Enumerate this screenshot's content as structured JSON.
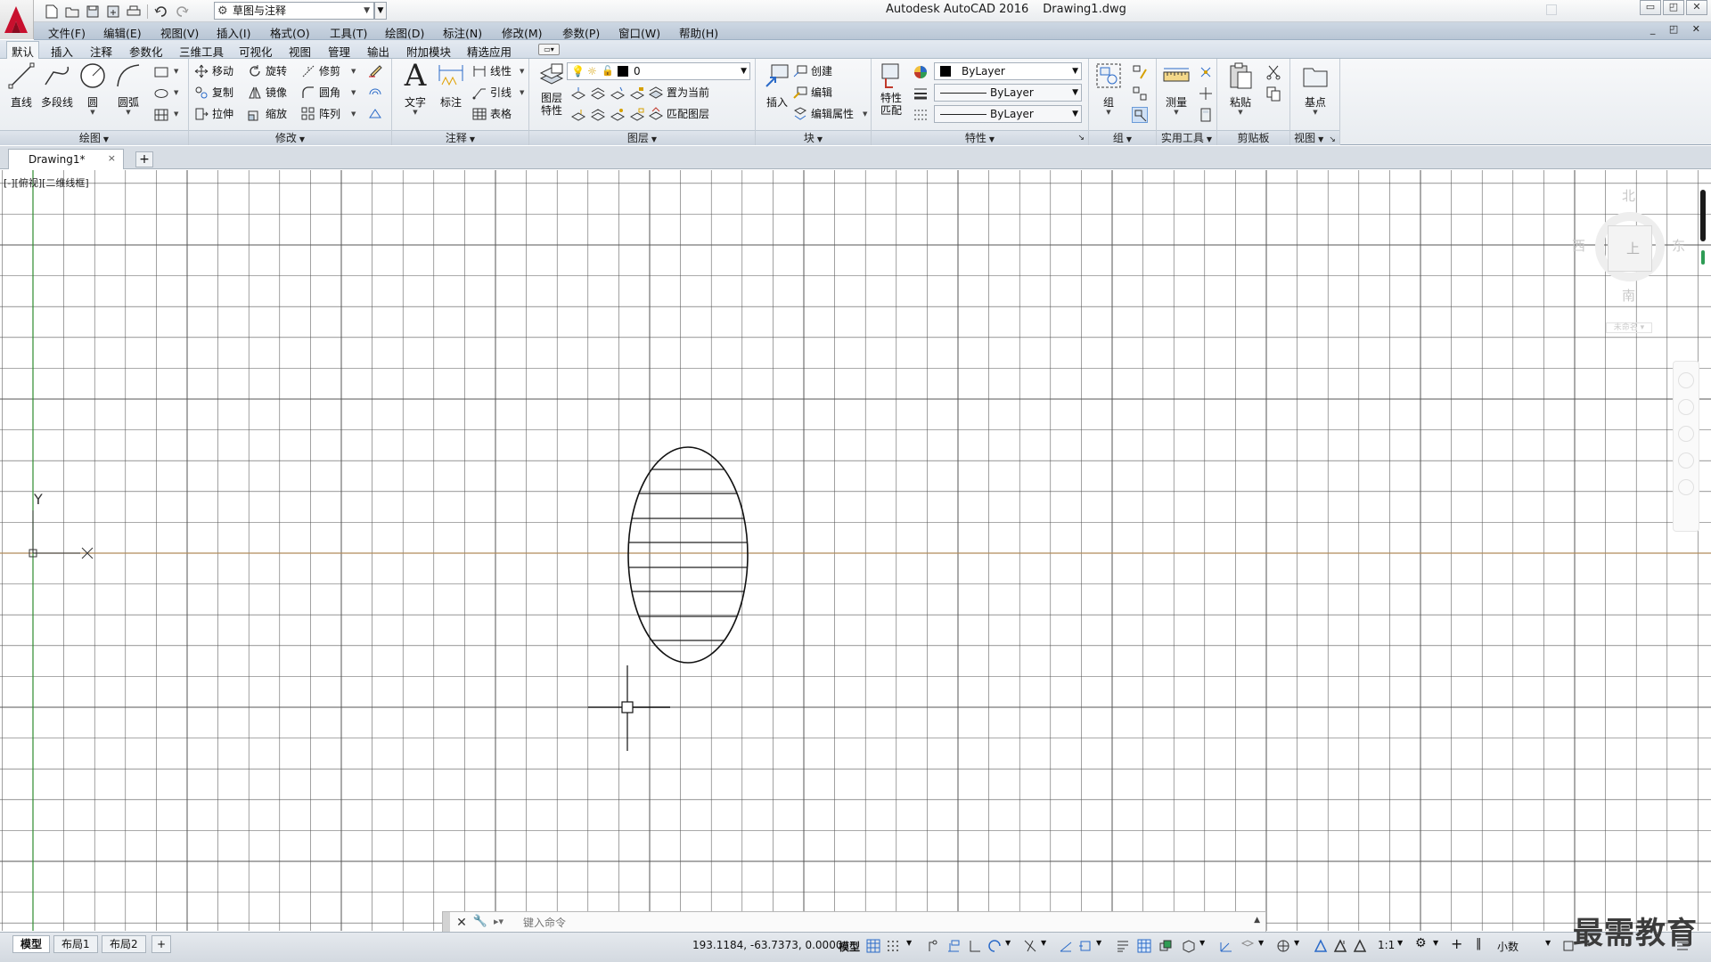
{
  "window": {
    "app_title": "Autodesk AutoCAD 2016",
    "document_title": "Drawing1.dwg",
    "workspace": "草图与注释",
    "controls": {
      "minimize": "▭",
      "restore": "◰",
      "close": "✕"
    }
  },
  "menu": [
    "文件(F)",
    "编辑(E)",
    "视图(V)",
    "插入(I)",
    "格式(O)",
    "工具(T)",
    "绘图(D)",
    "标注(N)",
    "修改(M)",
    "参数(P)",
    "窗口(W)",
    "帮助(H)"
  ],
  "menu_controls": "_ ◰ ✕",
  "ribbon_tabs": [
    "默认",
    "插入",
    "注释",
    "参数化",
    "三维工具",
    "可视化",
    "视图",
    "管理",
    "输出",
    "附加模块",
    "精选应用"
  ],
  "ribbon": {
    "draw": {
      "label": "绘图",
      "line": "直线",
      "polyline": "多段线",
      "circle": "圆",
      "arc": "圆弧"
    },
    "modify": {
      "label": "修改",
      "move": "移动",
      "rotate": "旋转",
      "trim": "修剪",
      "copy": "复制",
      "mirror": "镜像",
      "fillet": "圆角",
      "stretch": "拉伸",
      "scale": "缩放",
      "array": "阵列"
    },
    "annotation": {
      "label": "注释",
      "text": "文字",
      "dimension": "标注",
      "linear": "线性",
      "leader": "引线",
      "table": "表格"
    },
    "layers": {
      "label": "图层",
      "layer_properties_line1": "图层",
      "layer_properties_line2": "特性",
      "current_layer": "0",
      "set_current": "置为当前",
      "match_layer": "匹配图层"
    },
    "block": {
      "label": "块",
      "insert": "插入",
      "create": "创建",
      "edit": "编辑",
      "edit_attributes": "编辑属性"
    },
    "properties": {
      "label": "特性",
      "match_line1": "特性",
      "match_line2": "匹配",
      "color": "ByLayer",
      "linetype": "ByLayer",
      "lineweight": "ByLayer"
    },
    "groups": {
      "label": "组",
      "group": "组"
    },
    "utilities": {
      "label": "实用工具",
      "measure": "测量"
    },
    "clipboard": {
      "label": "剪贴板",
      "paste": "粘贴"
    },
    "view": {
      "label": "视图",
      "base": "基点"
    }
  },
  "file_tab": {
    "name": "Drawing1*",
    "close": "×",
    "new": "+"
  },
  "viewport": {
    "label": "[-][俯视][二维线框]",
    "viewcube": {
      "north": "北",
      "south": "南",
      "east": "东",
      "west": "西",
      "top_face": "上",
      "wcs": "未命名"
    },
    "ucs": {
      "x": "X",
      "y": "Y"
    }
  },
  "command_line": {
    "placeholder": "键入命令",
    "close": "✕",
    "customize": "🔧",
    "recent": "▸▾"
  },
  "layout_tabs": [
    "模型",
    "布局1",
    "布局2"
  ],
  "layout_add": "+",
  "status": {
    "coordinates": "193.1184, -63.7373, 0.0000",
    "model": "模型",
    "annotation_scale": "1:1",
    "units": "小数"
  },
  "watermark": "最需教育",
  "colors": {
    "ribbon_bg": "#eef1f4",
    "menubar_bg": "#c3cfdc",
    "grid_minor": "#555555",
    "x_axis": "#b08a5a",
    "y_axis": "#2e8b2e"
  }
}
